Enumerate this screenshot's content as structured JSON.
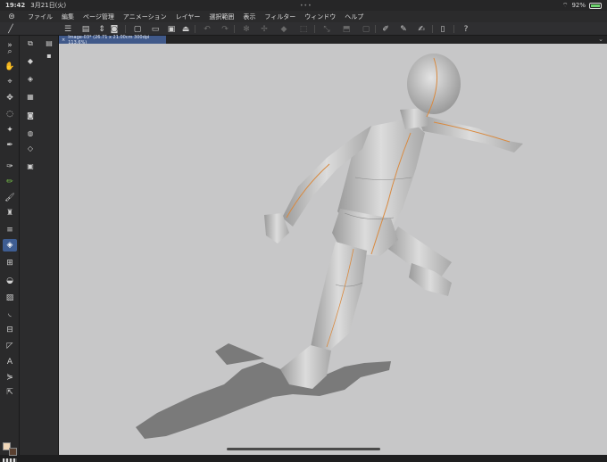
{
  "status": {
    "time": "19:42",
    "date": "3月21日(火)",
    "battery": "92%"
  },
  "menu": [
    "ファイル",
    "編集",
    "ページ管理",
    "アニメーション",
    "レイヤー",
    "選択範囲",
    "表示",
    "フィルター",
    "ウィンドウ",
    "ヘルプ"
  ],
  "tab": {
    "title": "Image-03* (26.71 x 21.00cm 300dpi 113.6%)"
  },
  "colors": {
    "accent": "#3e5d92",
    "canvas": "#c7c7c8",
    "figure": "#d4d4d4",
    "shadow": "#7a7a7a",
    "guide": "#d9893e"
  }
}
